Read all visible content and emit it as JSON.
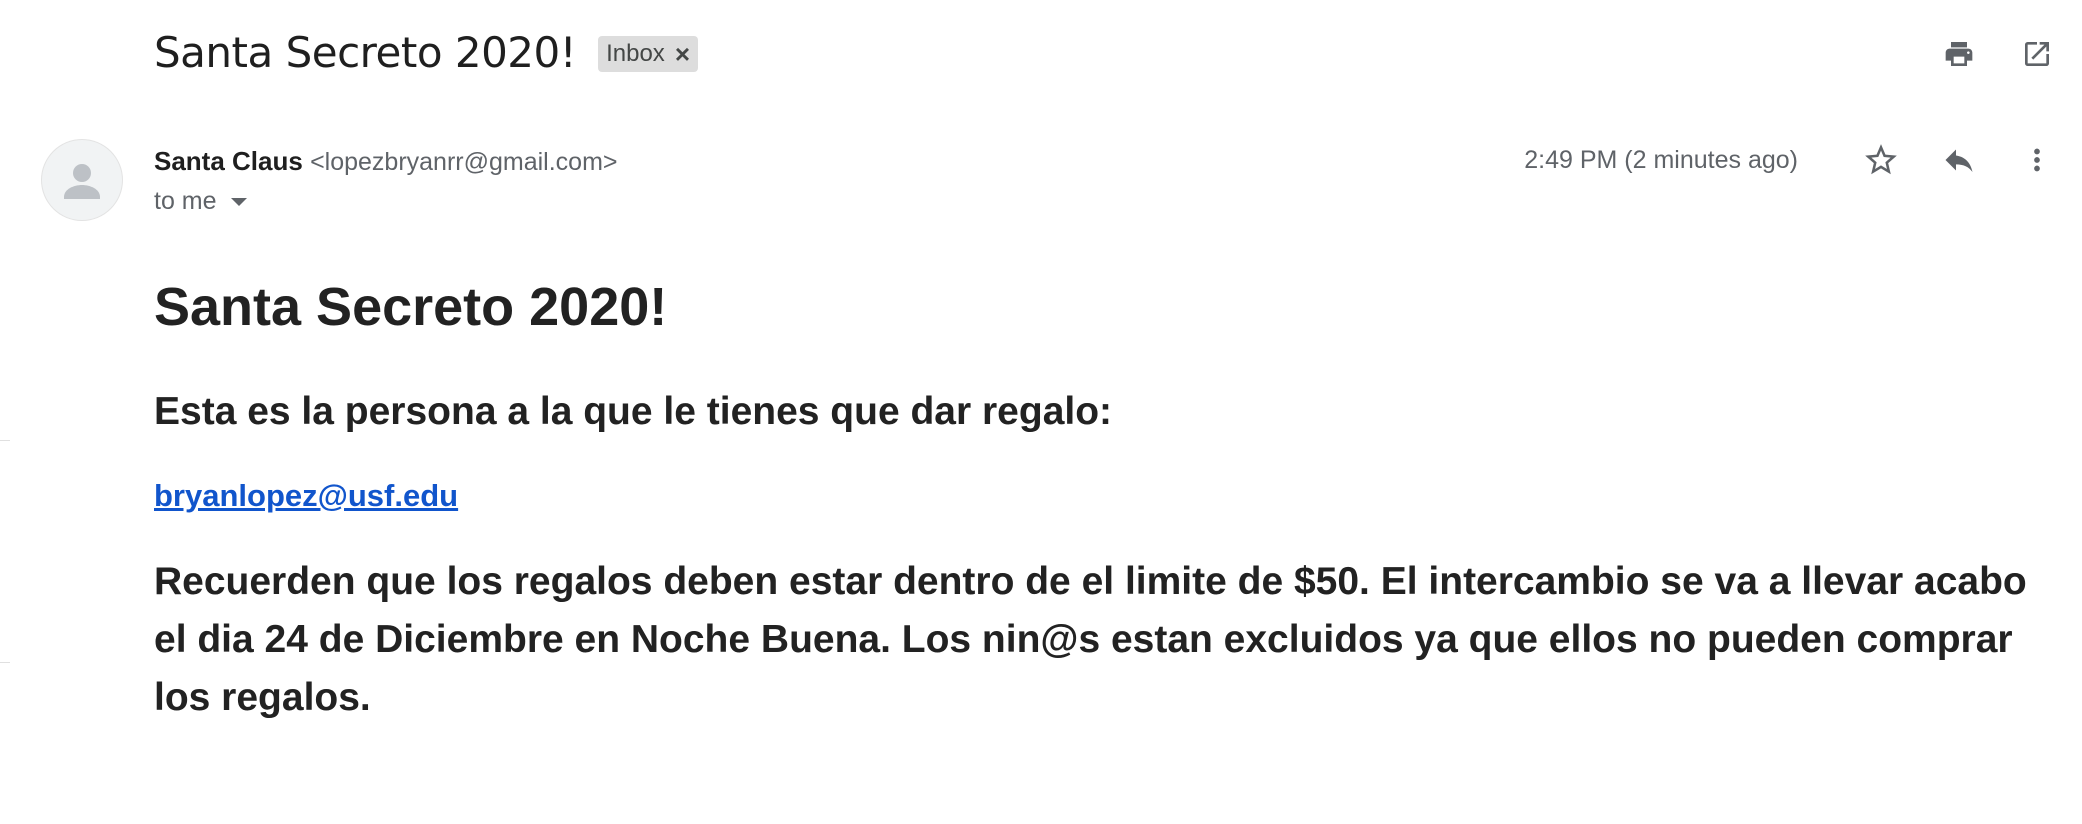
{
  "email": {
    "subject": "Santa Secreto 2020!",
    "label": "Inbox",
    "sender_name": "Santa Claus",
    "sender_email": "<lopezbryanrr@gmail.com>",
    "recipient": "to me",
    "timestamp": "2:49 PM (2 minutes ago)"
  },
  "toolbar": {
    "print_icon": "print-icon",
    "open_new_window_icon": "open-in-new-window-icon",
    "star_icon": "star-icon",
    "reply_icon": "reply-icon",
    "more_icon": "more-vert-icon"
  },
  "body": {
    "title": "Santa Secreto 2020!",
    "subtitle": "Esta es la persona a la que le tienes que dar regalo:",
    "link": "bryanlopez@usf.edu",
    "paragraph": "Recuerden que los regalos deben estar dentro de el limite de $50. El intercambio se va a llevar acabo el dia 24 de Diciembre en Noche Buena. Los nin@s estan excluidos ya que ellos no pueden comprar los regalos."
  },
  "colors": {
    "link": "#1155cc",
    "chip_bg": "#dddddd",
    "icon": "#5f6368"
  }
}
